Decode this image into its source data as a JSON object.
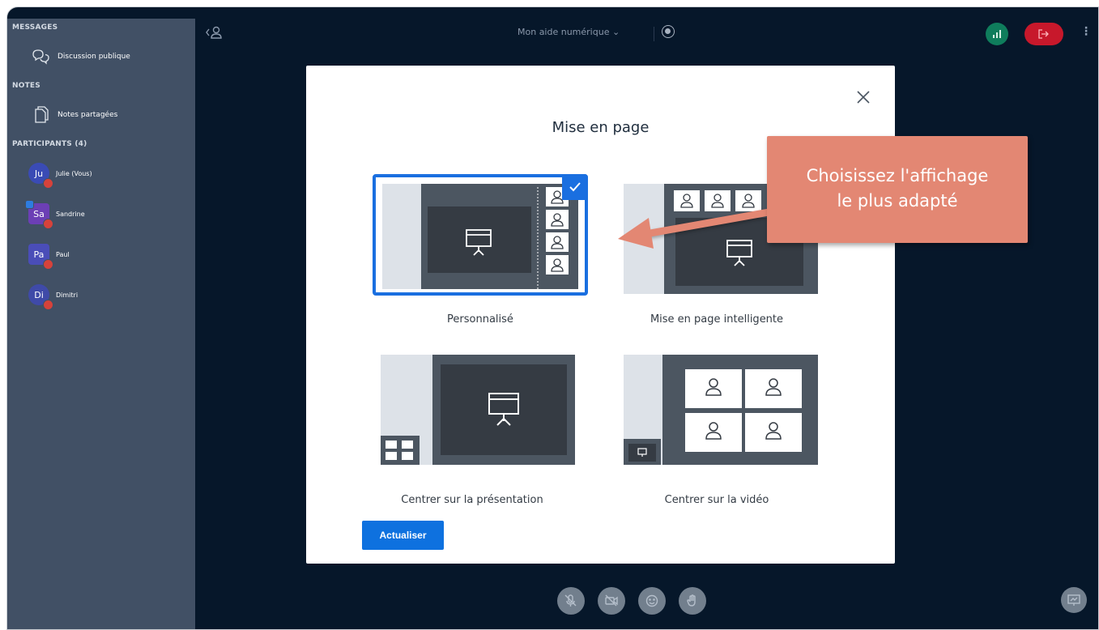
{
  "sidebar": {
    "messages_header": "MESSAGES",
    "public_chat_label": "Discussion publique",
    "notes_header": "NOTES",
    "shared_notes_label": "Notes partagées",
    "participants_header": "PARTICIPANTS (4)",
    "participants": [
      {
        "initials": "Ju",
        "name": "Julie (Vous)",
        "color": "#3a4bb5",
        "shape": "round"
      },
      {
        "initials": "Sa",
        "name": "Sandrine",
        "color": "#6c3fb5",
        "shape": "square"
      },
      {
        "initials": "Pa",
        "name": "Paul",
        "color": "#4a4db8",
        "shape": "square"
      },
      {
        "initials": "Di",
        "name": "Dimitri",
        "color": "#3f4aa8",
        "shape": "round"
      }
    ]
  },
  "topbar": {
    "meeting_title": "Mon aide numérique ⌄",
    "connection_icon": "signal-bars-icon",
    "leave_icon": "leave-icon",
    "more_icon": "more-vertical-icon"
  },
  "modal": {
    "title": "Mise en page",
    "close_icon": "close-icon",
    "options": [
      {
        "label": "Personnalisé",
        "selected": true
      },
      {
        "label": "Mise en page intelligente",
        "selected": false
      },
      {
        "label": "Centrer sur la présentation",
        "selected": false
      },
      {
        "label": "Centrer sur la vidéo",
        "selected": false
      }
    ],
    "update_button": "Actualiser"
  },
  "callout": {
    "line1": "Choisissez l'affichage",
    "line2": "le plus adapté"
  },
  "colors": {
    "accent": "#1a6fe0",
    "callout": "#e38773",
    "sidebar": "#415065",
    "stage": "#06172a"
  }
}
